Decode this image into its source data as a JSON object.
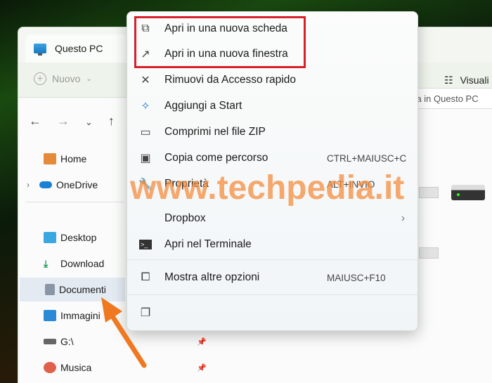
{
  "window": {
    "tab_title": "Questo PC",
    "toolbar": {
      "new_label": "Nuovo",
      "view_label": "Visuali"
    },
    "search_placeholder": "Cerca in Questo PC"
  },
  "sidebar": {
    "items": [
      {
        "label": "Home",
        "icon": "home-icon"
      },
      {
        "label": "OneDrive",
        "icon": "cloud-icon"
      },
      {
        "label": "Desktop",
        "icon": "desktop-icon"
      },
      {
        "label": "Download",
        "icon": "download-icon"
      },
      {
        "label": "Documenti",
        "icon": "document-icon"
      },
      {
        "label": "Immagini",
        "icon": "image-icon"
      },
      {
        "label": "G:\\",
        "icon": "drive-icon"
      },
      {
        "label": "Musica",
        "icon": "music-icon"
      }
    ]
  },
  "context_menu": {
    "items": [
      {
        "label": "Apri in una nuova scheda",
        "icon": "new-tab-icon"
      },
      {
        "label": "Apri in una nuova finestra",
        "icon": "new-window-icon"
      },
      {
        "label": "Rimuovi da Accesso rapido",
        "icon": "unpin-icon"
      },
      {
        "label": "Aggiungi a Start",
        "icon": "pin-icon"
      },
      {
        "label": "Comprimi nel file ZIP",
        "icon": "zip-icon"
      },
      {
        "label": "Copia come percorso",
        "icon": "copy-path-icon",
        "shortcut": "CTRL+MAIUSC+C"
      },
      {
        "label": "Proprietà",
        "icon": "wrench-icon",
        "shortcut": "ALT+INVIO"
      },
      {
        "label": "Dropbox",
        "icon": "",
        "submenu": true
      },
      {
        "label": "Apri nel Terminale",
        "icon": "terminal-icon"
      },
      {
        "label": "Mostra altre opzioni",
        "icon": "more-options-icon",
        "shortcut": "MAIUSC+F10"
      }
    ]
  },
  "watermark": "www.techpedia.it",
  "colors": {
    "highlight_box": "#d8202a",
    "arrow": "#f07820",
    "watermark": "#f48c3c"
  }
}
